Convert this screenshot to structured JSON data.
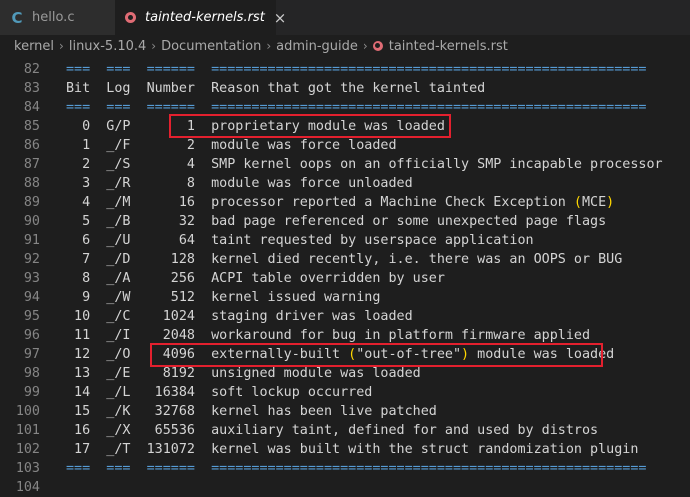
{
  "tabs": [
    {
      "label": "hello.c",
      "icon": "c-file-icon",
      "active": false
    },
    {
      "label": "tainted-kernels.rst",
      "icon": "rst-file-icon",
      "active": true,
      "close": "×"
    }
  ],
  "breadcrumb": [
    "kernel",
    "linux-5.10.4",
    "Documentation",
    "admin-guide",
    "tainted-kernels.rst"
  ],
  "breadcrumb_separator": "›",
  "lines": [
    {
      "ln": "82",
      "text": "===  ===  ======  ======================================================"
    },
    {
      "ln": "83",
      "text": "Bit  Log  Number  Reason that got the kernel tainted"
    },
    {
      "ln": "84",
      "text": "===  ===  ======  ======================================================"
    },
    {
      "ln": "85",
      "text": "  0  G/P       1  proprietary module was loaded"
    },
    {
      "ln": "86",
      "text": "  1  _/F       2  module was force loaded"
    },
    {
      "ln": "87",
      "text": "  2  _/S       4  SMP kernel oops on an officially SMP incapable processor"
    },
    {
      "ln": "88",
      "text": "  3  _/R       8  module was force unloaded"
    },
    {
      "ln": "89",
      "text": "  4  _/M      16  processor reported a Machine Check Exception (MCE)"
    },
    {
      "ln": "90",
      "text": "  5  _/B      32  bad page referenced or some unexpected page flags"
    },
    {
      "ln": "91",
      "text": "  6  _/U      64  taint requested by userspace application"
    },
    {
      "ln": "92",
      "text": "  7  _/D     128  kernel died recently, i.e. there was an OOPS or BUG"
    },
    {
      "ln": "93",
      "text": "  8  _/A     256  ACPI table overridden by user"
    },
    {
      "ln": "94",
      "text": "  9  _/W     512  kernel issued warning"
    },
    {
      "ln": "95",
      "text": " 10  _/C    1024  staging driver was loaded"
    },
    {
      "ln": "96",
      "text": " 11  _/I    2048  workaround for bug in platform firmware applied"
    },
    {
      "ln": "97",
      "text": " 12  _/O    4096  externally-built (\"out-of-tree\") module was loaded"
    },
    {
      "ln": "98",
      "text": " 13  _/E    8192  unsigned module was loaded"
    },
    {
      "ln": "99",
      "text": " 14  _/L   16384  soft lockup occurred"
    },
    {
      "ln": "100",
      "text": " 15  _/K   32768  kernel has been live patched"
    },
    {
      "ln": "101",
      "text": " 16  _/X   65536  auxiliary taint, defined for and used by distros"
    },
    {
      "ln": "102",
      "text": " 17  _/T  131072  kernel was built with the struct randomization plugin"
    },
    {
      "ln": "103",
      "text": "===  ===  ======  ======================================================"
    },
    {
      "ln": "104",
      "text": ""
    }
  ],
  "colors": {
    "background": "#1e1e1e",
    "text": "#d4d4d4",
    "line_number": "#858585",
    "heading_rule": "#569cd6",
    "bracket": "#ffd700",
    "highlight_box": "#e3202e",
    "c_icon": "#519aba",
    "rst_icon": "#e06c75"
  }
}
